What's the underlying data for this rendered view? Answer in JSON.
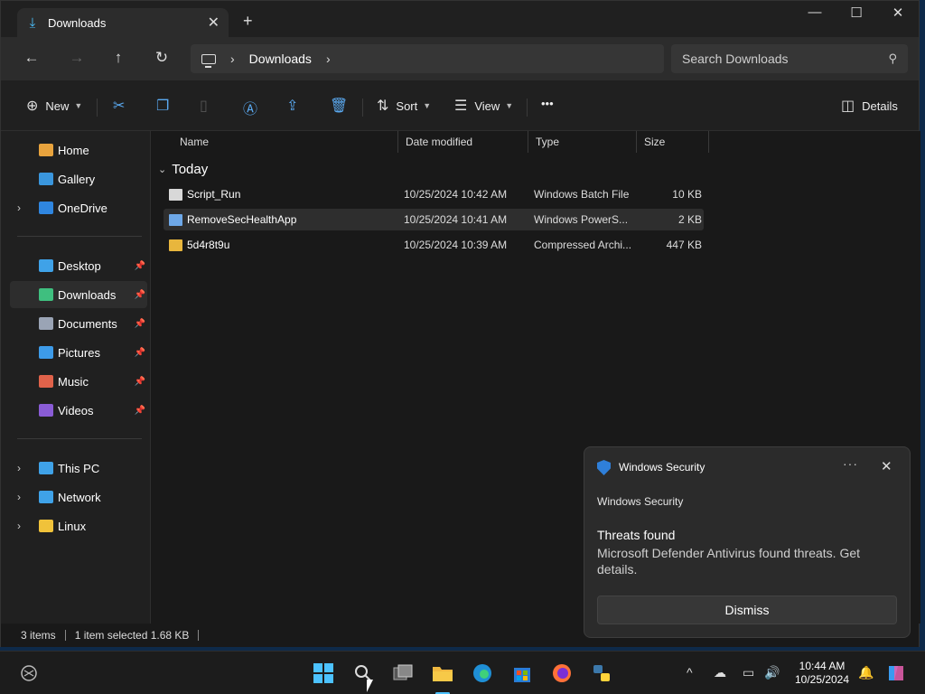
{
  "tab": {
    "title": "Downloads",
    "close": "✕",
    "new_tab": "+"
  },
  "window_controls": {
    "minimize": "—",
    "maximize": "☐",
    "close": "✕"
  },
  "nav": {
    "back": "←",
    "forward": "→",
    "up": "↑",
    "refresh": "↻"
  },
  "address": {
    "chevron": "›",
    "crumb": "Downloads",
    "trailing_chevron": "›"
  },
  "search": {
    "placeholder": "Search Downloads",
    "icon": "search-icon"
  },
  "commands": {
    "new": "New",
    "sort": "Sort",
    "view": "View",
    "more": "•••",
    "details": "Details"
  },
  "sidebar": {
    "group1": [
      {
        "label": "Home",
        "icon": "home-icon",
        "color": "#e8a33d"
      },
      {
        "label": "Gallery",
        "icon": "gallery-icon",
        "color": "#3a96dd"
      },
      {
        "label": "OneDrive",
        "icon": "onedrive-icon",
        "color": "#2f86e0"
      }
    ],
    "group2": [
      {
        "label": "Desktop",
        "icon": "desktop-icon",
        "color": "#3fa2e8"
      },
      {
        "label": "Downloads",
        "icon": "downloads-icon",
        "color": "#3fbf7f"
      },
      {
        "label": "Documents",
        "icon": "documents-icon",
        "color": "#9aa4b5"
      },
      {
        "label": "Pictures",
        "icon": "pictures-icon",
        "color": "#3d9be9"
      },
      {
        "label": "Music",
        "icon": "music-icon",
        "color": "#e0624a"
      },
      {
        "label": "Videos",
        "icon": "videos-icon",
        "color": "#8a5cd6"
      }
    ],
    "group3": [
      {
        "label": "This PC",
        "icon": "this-pc-icon",
        "color": "#3fa2e8"
      },
      {
        "label": "Network",
        "icon": "network-icon",
        "color": "#3fa2e8"
      },
      {
        "label": "Linux",
        "icon": "linux-icon",
        "color": "#f0c23a"
      }
    ],
    "pin": "📌"
  },
  "columns": {
    "name": "Name",
    "date": "Date modified",
    "type": "Type",
    "size": "Size"
  },
  "group_label": "Today",
  "files": [
    {
      "name": "Script_Run",
      "date": "10/25/2024 10:42 AM",
      "type": "Windows Batch File",
      "size": "10 KB",
      "icon": "batch-file-icon",
      "color": "#d8d8d8"
    },
    {
      "name": "RemoveSecHealthApp",
      "date": "10/25/2024 10:41 AM",
      "type": "Windows PowerS...",
      "size": "2 KB",
      "icon": "powershell-file-icon",
      "color": "#6ea8e8"
    },
    {
      "name": "5d4r8t9u",
      "date": "10/25/2024 10:39 AM",
      "type": "Compressed Archi...",
      "size": "447 KB",
      "icon": "zip-folder-icon",
      "color": "#e8b63d"
    }
  ],
  "status": {
    "count": "3 items",
    "selection": "1 item selected  1.68 KB"
  },
  "toast": {
    "app": "Windows Security",
    "more": "···",
    "close": "✕",
    "sub": "Windows Security",
    "title": "Threats found",
    "body": "Microsoft Defender Antivirus found threats. Get details.",
    "dismiss": "Dismiss"
  },
  "taskbar": {
    "clock_time": "10:44 AM",
    "clock_date": "10/25/2024",
    "tray_chevron": "^"
  }
}
